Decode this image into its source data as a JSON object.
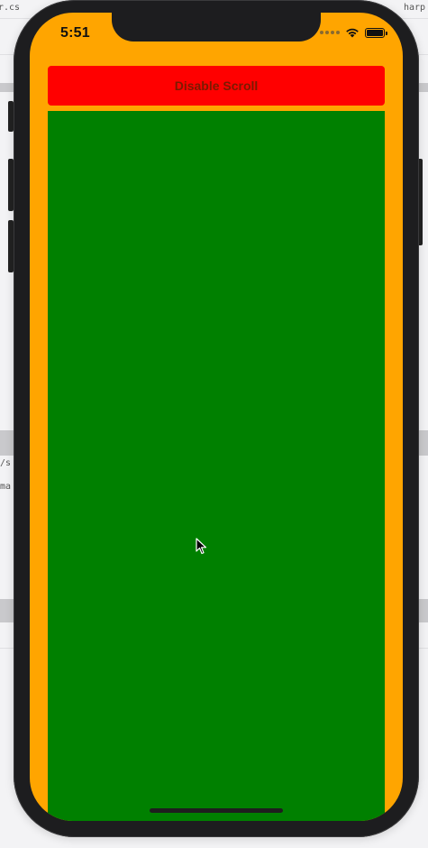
{
  "background_window": {
    "tab_left_fragment": "r.cs",
    "tab_right_fragment": "harp",
    "code_fragment_1": "/s",
    "code_fragment_2": "ma"
  },
  "status_bar": {
    "time": "5:51",
    "icons": [
      "cellular-dots-icon",
      "wifi-icon",
      "battery-icon"
    ]
  },
  "app": {
    "disable_button_label": "Disable Scroll",
    "colors": {
      "background": "#ffa500",
      "button": "#ff0000",
      "scroll_area": "#008000"
    }
  }
}
